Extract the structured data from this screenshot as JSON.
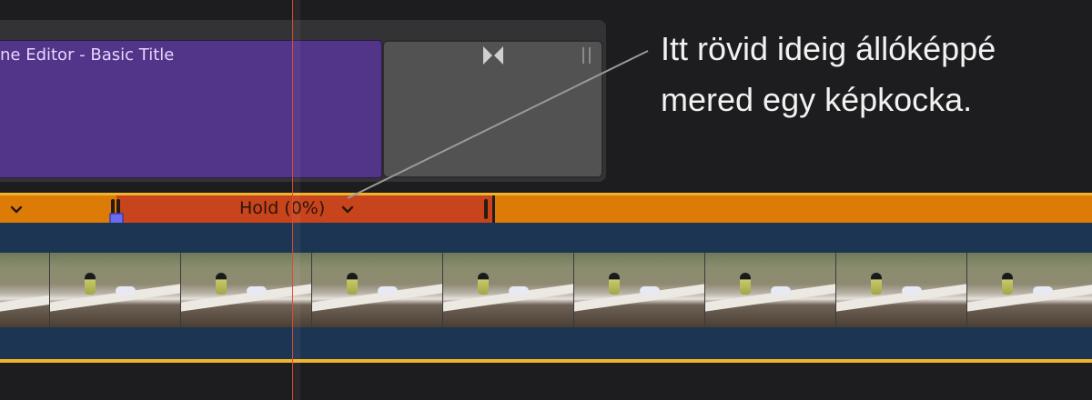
{
  "timeline": {
    "title_clip": {
      "label": "ne Editor - Basic Title"
    },
    "retime": {
      "hold_label": "Hold (0%)"
    }
  },
  "annotation": {
    "line1": "Itt rövid ideig állóképpé",
    "line2": "mered egy képkocka."
  },
  "colors": {
    "background": "#1d1d1f",
    "title_clip": "#523488",
    "gap_clip": "#525252",
    "retime_normal": "#dc7b06",
    "retime_hold": "#c8441c",
    "clip_selection": "#f1b32a",
    "video_clip": "#1c3553",
    "playhead": "#e04a2e",
    "hold_marker": "#6b6cf0"
  },
  "icons": {
    "transition": "bowtie-transition-icon",
    "grip": "clip-grip-icon",
    "retime_menu": "chevron-down-icon",
    "hold_marker": "keyframe-marker-icon"
  }
}
